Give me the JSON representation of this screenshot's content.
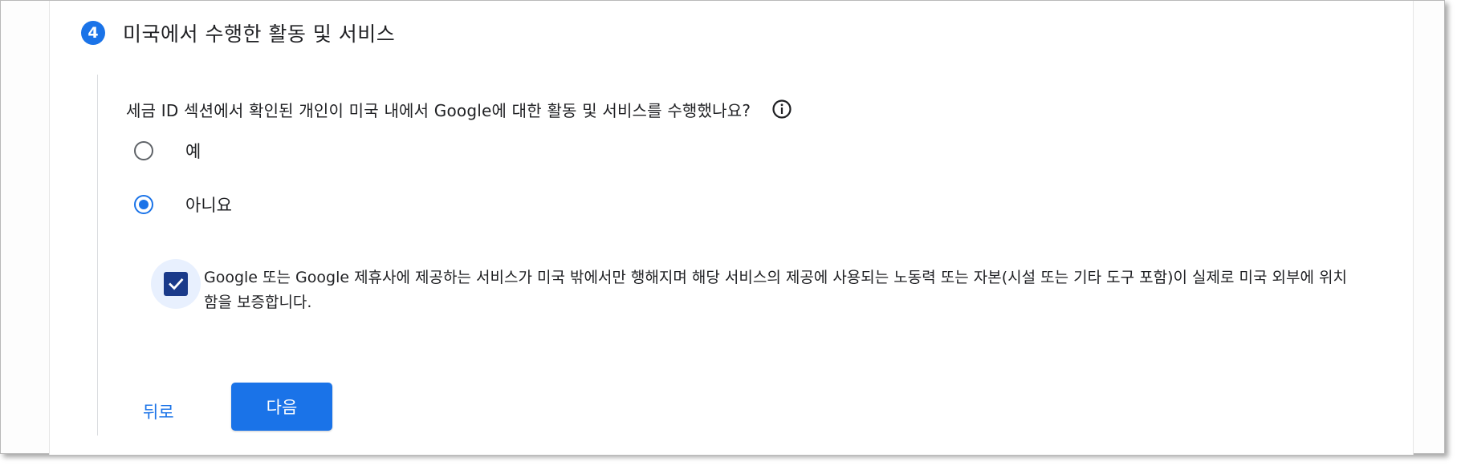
{
  "step": {
    "number": "4",
    "title": "미국에서 수행한 활동 및 서비스"
  },
  "question": {
    "text": "세금 ID 섹션에서 확인된 개인이 미국 내에서 Google에 대한 활동 및 서비스를 수행했나요?",
    "info_icon": "info-icon"
  },
  "options": [
    {
      "label": "예",
      "selected": false
    },
    {
      "label": "아니요",
      "selected": true
    }
  ],
  "certification": {
    "checked": true,
    "text": "Google 또는 Google 제휴사에 제공하는 서비스가 미국 밖에서만 행해지며 해당 서비스의 제공에 사용되는 노동력 또는 자본(시설 또는 기타 도구 포함)이 실제로 미국 외부에 위치함을 보증합니다."
  },
  "buttons": {
    "back": "뒤로",
    "next": "다음"
  },
  "colors": {
    "accent": "#1a73e8",
    "checkbox": "#1a3a8a",
    "halo": "#e8f0fe"
  }
}
